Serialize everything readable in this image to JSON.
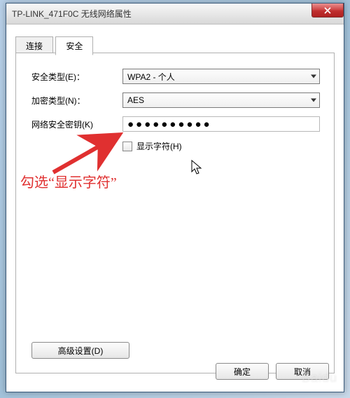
{
  "window": {
    "title": "TP-LINK_471F0C 无线网络属性"
  },
  "tabs": {
    "connect": "连接",
    "security": "安全"
  },
  "form": {
    "security_type_label": "安全类型(E)：",
    "security_type_value": "WPA2 - 个人",
    "encryption_label": "加密类型(N)：",
    "encryption_value": "AES",
    "key_label": "网络安全密钥(K)",
    "key_value_masked": "●●●●●●●●●●",
    "show_chars_label": "显示字符(H)"
  },
  "annotation": {
    "text": "勾选“显示字符”"
  },
  "buttons": {
    "advanced": "高级设置(D)",
    "ok": "确定",
    "cancel": "取消"
  },
  "watermark": "Baidu"
}
